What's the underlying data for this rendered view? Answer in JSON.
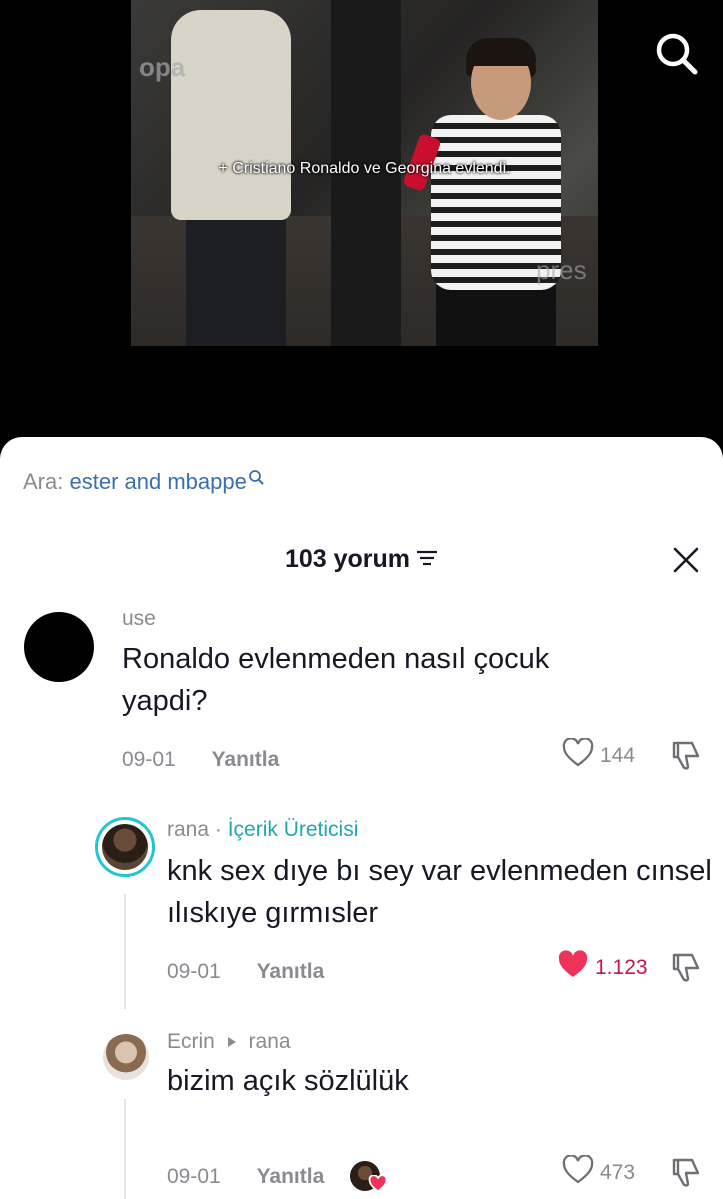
{
  "video": {
    "caption": "+ Cristiano Ronaldo ve Georgina evlendi.",
    "watermark_top": "opa",
    "watermark_bottom": "pres"
  },
  "search_suggestion": {
    "prefix": "Ara:",
    "query": "ester and mbappe"
  },
  "comments_header": {
    "title": "103 yorum"
  },
  "comments": [
    {
      "username": "use",
      "text": "Ronaldo evlenmeden nasıl çocuk yapdi?",
      "date": "09-01",
      "reply_label": "Yanıtla",
      "likes": "144"
    },
    {
      "username": "rana",
      "separator": " · ",
      "badge": "İçerik Üreticisi",
      "text": "knk sex dıye bı sey var evlenmeden cınsel ılıskıye gırmısler",
      "date": "09-01",
      "reply_label": "Yanıtla",
      "likes": "1.123",
      "liked": true
    },
    {
      "username": "Ecrin",
      "reply_to": "rana",
      "text": "bizim açık sözlülük",
      "date": "09-01",
      "reply_label": "Yanıtla",
      "likes": "473"
    }
  ],
  "colors": {
    "accent_link": "#3b6fb0",
    "creator_badge": "#20a8b2",
    "liked_heart": "#f0325a"
  }
}
